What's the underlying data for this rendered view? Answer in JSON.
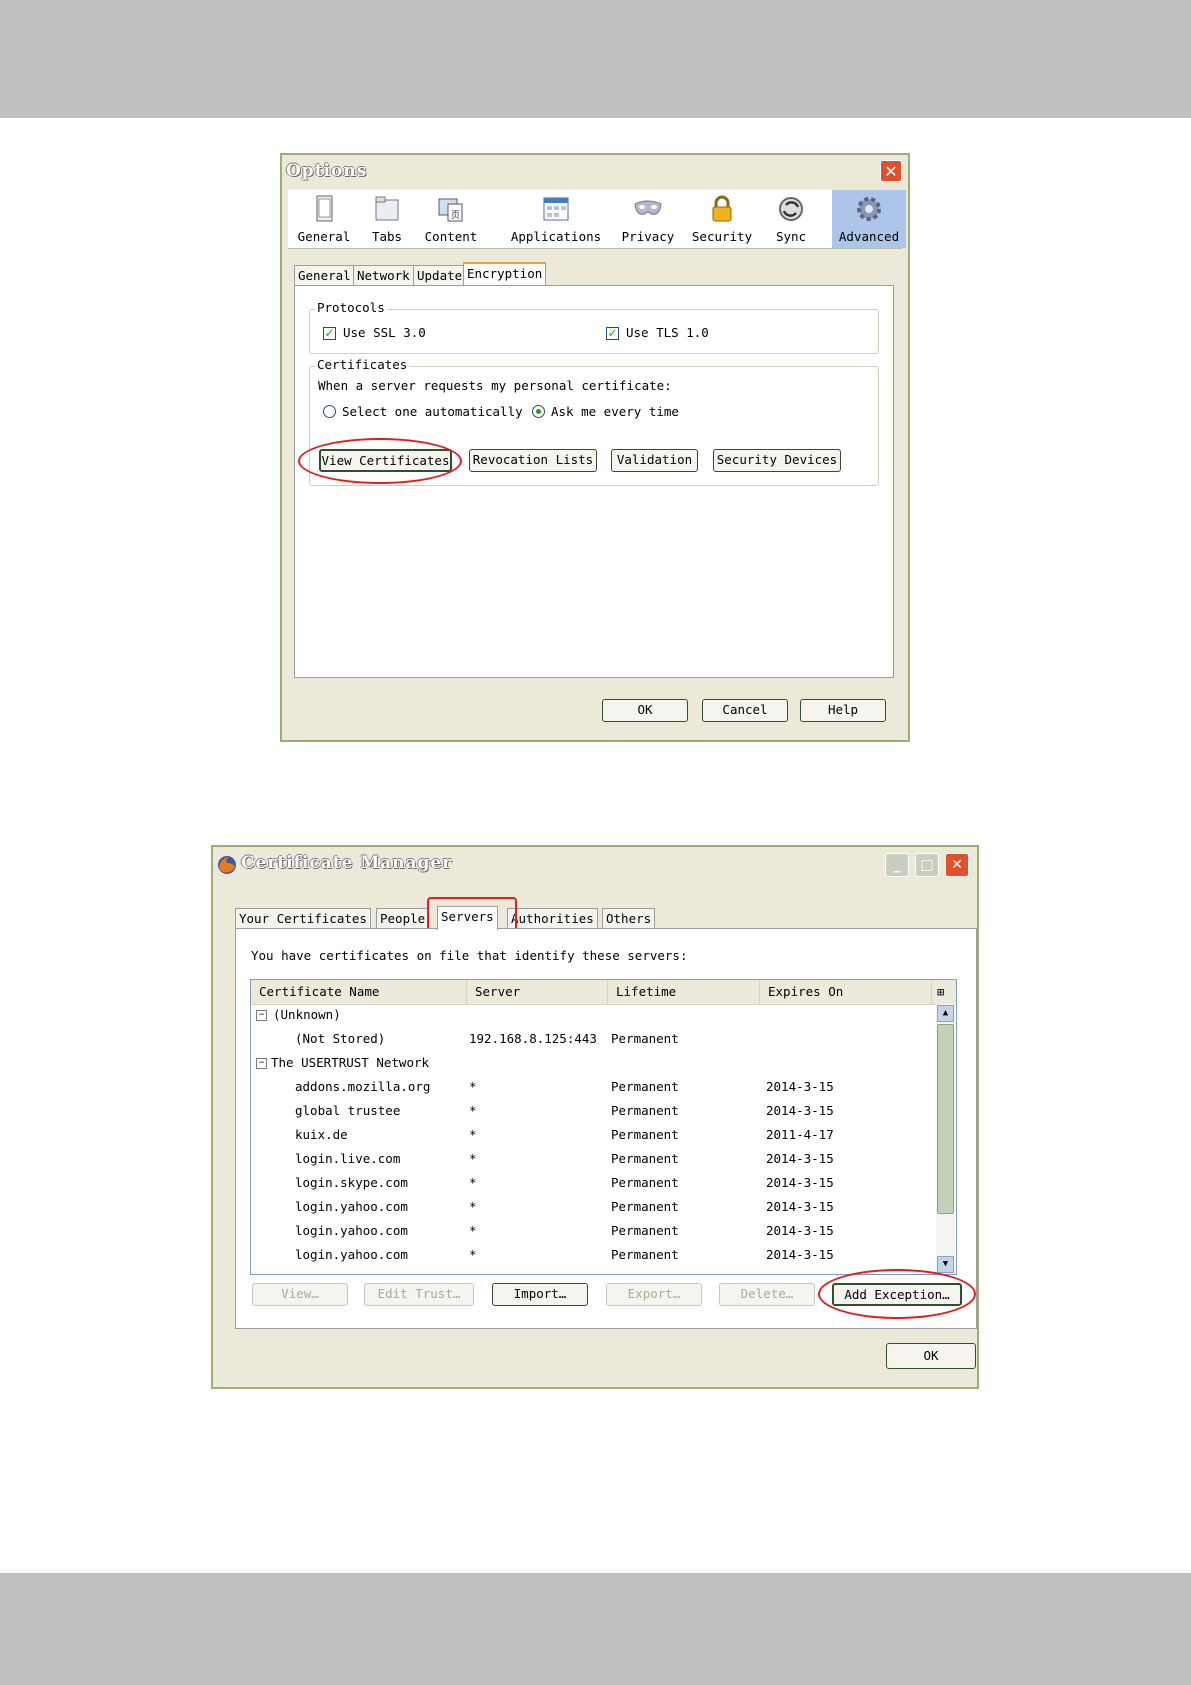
{
  "options": {
    "title": "Options",
    "toolbar": [
      "General",
      "Tabs",
      "Content",
      "Applications",
      "Privacy",
      "Security",
      "Sync",
      "Advanced"
    ],
    "tabs": [
      "General",
      "Network",
      "Update",
      "Encryption"
    ],
    "protocols": {
      "label": "Protocols",
      "ssl": "Use SSL 3.0",
      "tls": "Use TLS 1.0"
    },
    "certificates": {
      "label": "Certificates",
      "prompt": "When a server requests my personal certificate:",
      "auto": "Select one automatically",
      "ask": "Ask me every time"
    },
    "buttons": [
      "View Certificates",
      "Revocation Lists",
      "Validation",
      "Security Devices"
    ],
    "footer": {
      "ok": "OK",
      "cancel": "Cancel",
      "help": "Help"
    }
  },
  "cert_manager": {
    "title": "Certificate Manager",
    "tabs": [
      "Your Certificates",
      "People",
      "Servers",
      "Authorities",
      "Others"
    ],
    "intro": "You have certificates on file that identify these servers:",
    "columns": [
      "Certificate Name",
      "Server",
      "Lifetime",
      "Expires On"
    ],
    "groups": [
      "(Unknown)",
      "The USERTRUST Network"
    ],
    "rows": [
      {
        "name": "(Not Stored)",
        "server": "192.168.8.125:443",
        "lifetime": "Permanent",
        "expires": ""
      },
      {
        "name": "addons.mozilla.org",
        "server": "*",
        "lifetime": "Permanent",
        "expires": "2014-3-15"
      },
      {
        "name": "global trustee",
        "server": "*",
        "lifetime": "Permanent",
        "expires": "2014-3-15"
      },
      {
        "name": "kuix.de",
        "server": "*",
        "lifetime": "Permanent",
        "expires": "2011-4-17"
      },
      {
        "name": "login.live.com",
        "server": "*",
        "lifetime": "Permanent",
        "expires": "2014-3-15"
      },
      {
        "name": "login.skype.com",
        "server": "*",
        "lifetime": "Permanent",
        "expires": "2014-3-15"
      },
      {
        "name": "login.yahoo.com",
        "server": "*",
        "lifetime": "Permanent",
        "expires": "2014-3-15"
      },
      {
        "name": "login.yahoo.com",
        "server": "*",
        "lifetime": "Permanent",
        "expires": "2014-3-15"
      },
      {
        "name": "login.yahoo.com",
        "server": "*",
        "lifetime": "Permanent",
        "expires": "2014-3-15"
      }
    ],
    "buttons": [
      "View…",
      "Edit Trust…",
      "Import…",
      "Export…",
      "Delete…",
      "Add Exception…"
    ],
    "ok": "OK"
  }
}
